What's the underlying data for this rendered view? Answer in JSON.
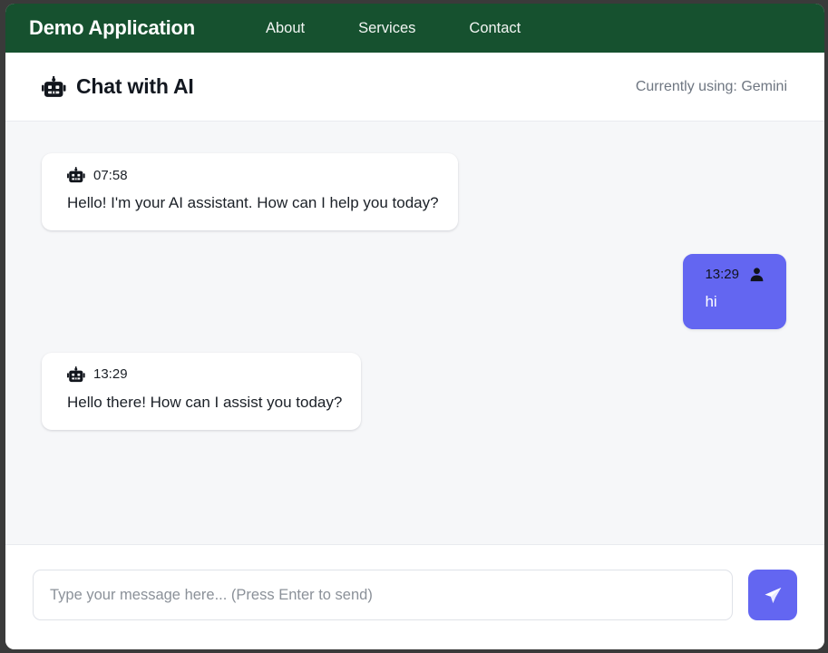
{
  "window": {
    "frame_color": "#3a3a3a"
  },
  "navbar": {
    "brand": "Demo Application",
    "background_color": "#16512f",
    "links": [
      {
        "label": "About"
      },
      {
        "label": "Services"
      },
      {
        "label": "Contact"
      }
    ]
  },
  "chat_header": {
    "icon": "robot-icon",
    "title": "Chat with AI",
    "status": "Currently using: Gemini"
  },
  "conversation": {
    "messages": [
      {
        "role": "ai",
        "icon": "robot-icon",
        "time": "07:58",
        "text": "Hello! I'm your AI assistant. How can I help you today?"
      },
      {
        "role": "user",
        "icon": "person-icon",
        "time": "13:29",
        "text": "hi"
      },
      {
        "role": "ai",
        "icon": "robot-icon",
        "time": "13:29",
        "text": "Hello there! How can I assist you today?"
      }
    ]
  },
  "composer": {
    "placeholder": "Type your message here... (Press Enter to send)",
    "value": "",
    "send_icon": "paper-plane-icon",
    "send_label": "",
    "accent_color": "#6366f1"
  }
}
